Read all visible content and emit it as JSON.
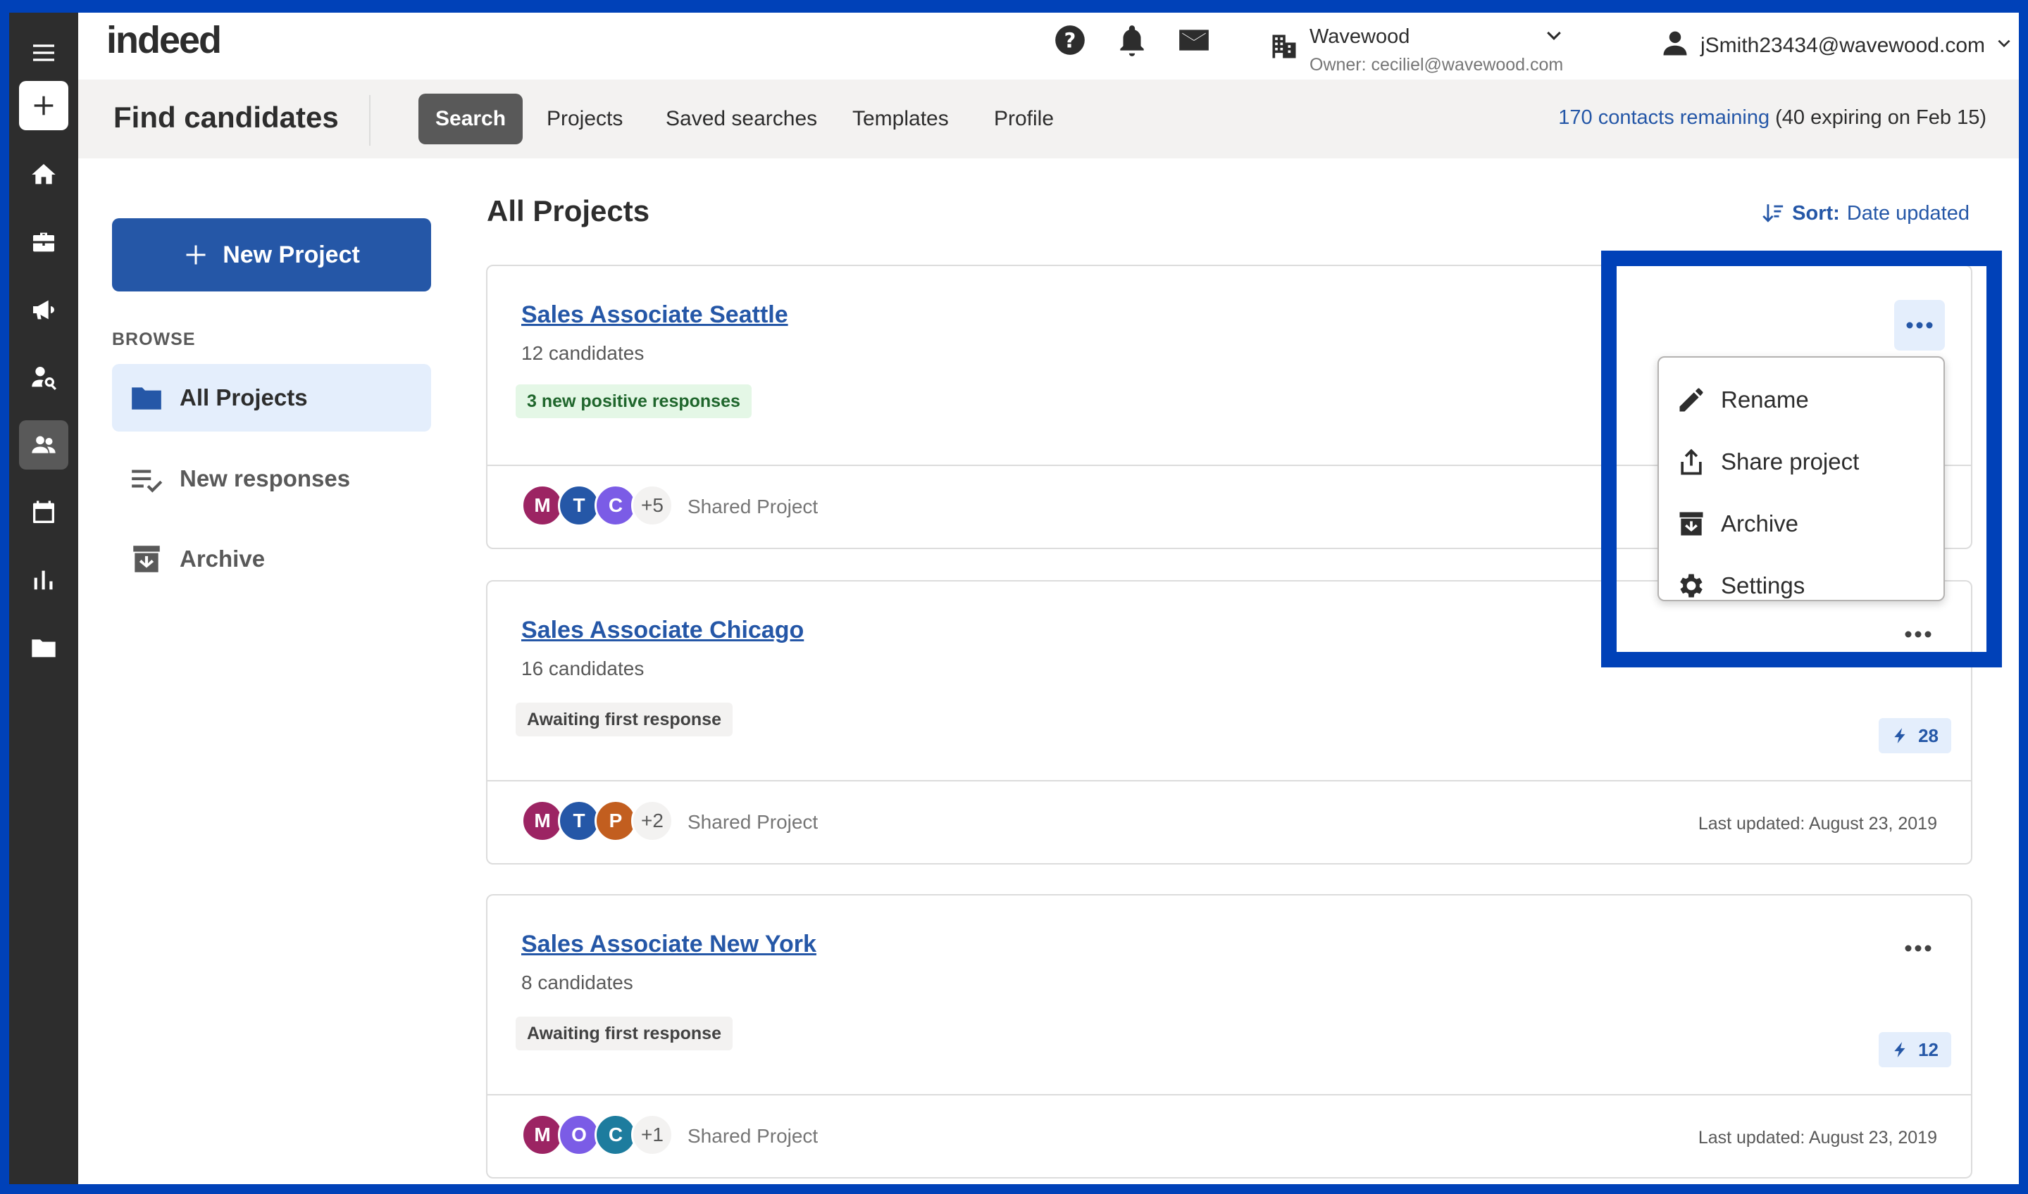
{
  "topbar": {
    "logo": "indeed",
    "company_name": "Wavewood",
    "company_owner": "Owner: ceciliel@wavewood.com",
    "account_email": "jSmith23434@wavewood.com",
    "icons": [
      "help-icon",
      "bell-icon",
      "mail-icon",
      "building-icon",
      "chevron-down-icon",
      "user-icon"
    ]
  },
  "rail": {
    "icons": [
      "menu-icon",
      "plus-icon",
      "home-icon",
      "briefcase-icon",
      "megaphone-icon",
      "person-search-icon",
      "people-icon",
      "calendar-icon",
      "bar-chart-icon",
      "folder-icon"
    ]
  },
  "subnav": {
    "title": "Find candidates",
    "tabs": [
      {
        "label": "Search"
      },
      {
        "label": "Projects"
      },
      {
        "label": "Saved searches"
      },
      {
        "label": "Templates"
      },
      {
        "label": "Profile"
      }
    ],
    "contacts_link": "170 contacts remaining",
    "contacts_note": " (40 expiring on Feb 15)"
  },
  "sidebar": {
    "new_project_label": "New Project",
    "browse_label": "BROWSE",
    "items": [
      {
        "label": "All Projects"
      },
      {
        "label": "New responses"
      },
      {
        "label": "Archive"
      }
    ]
  },
  "main": {
    "title": "All Projects",
    "sort_label": "Sort:",
    "sort_value": "Date updated"
  },
  "projects": [
    {
      "title": "Sales Associate Seattle",
      "count": "12 candidates",
      "badge": "3 new positive responses",
      "avatars": [
        {
          "letter": "M",
          "color": "#9c2463"
        },
        {
          "letter": "T",
          "color": "#2557a7"
        },
        {
          "letter": "C",
          "color": "#7b5ce6"
        }
      ],
      "more": "+5",
      "shared": "Shared Project"
    },
    {
      "title": "Sales Associate Chicago",
      "count": "16 candidates",
      "badge": "Awaiting first response",
      "bolt_count": "28",
      "avatars": [
        {
          "letter": "M",
          "color": "#9c2463"
        },
        {
          "letter": "T",
          "color": "#2557a7"
        },
        {
          "letter": "P",
          "color": "#c25e1f"
        }
      ],
      "more": "+2",
      "shared": "Shared Project",
      "updated": "Last updated: August 23, 2019"
    },
    {
      "title": "Sales Associate New York",
      "count": "8 candidates",
      "badge": "Awaiting first response",
      "bolt_count": "12",
      "avatars": [
        {
          "letter": "M",
          "color": "#9c2463"
        },
        {
          "letter": "O",
          "color": "#7b5ce6"
        },
        {
          "letter": "C",
          "color": "#1d7c9e"
        }
      ],
      "more": "+1",
      "shared": "Shared Project",
      "updated": "Last updated: August 23, 2019"
    }
  ],
  "menu": {
    "items": [
      {
        "label": "Rename",
        "icon": "pencil-icon"
      },
      {
        "label": "Share project",
        "icon": "share-icon"
      },
      {
        "label": "Archive",
        "icon": "archive-icon"
      },
      {
        "label": "Settings",
        "icon": "gear-icon"
      }
    ]
  },
  "colors": {
    "accent": "#2557a7",
    "highlight": "#0041b8",
    "rail": "#2d2d2d"
  }
}
